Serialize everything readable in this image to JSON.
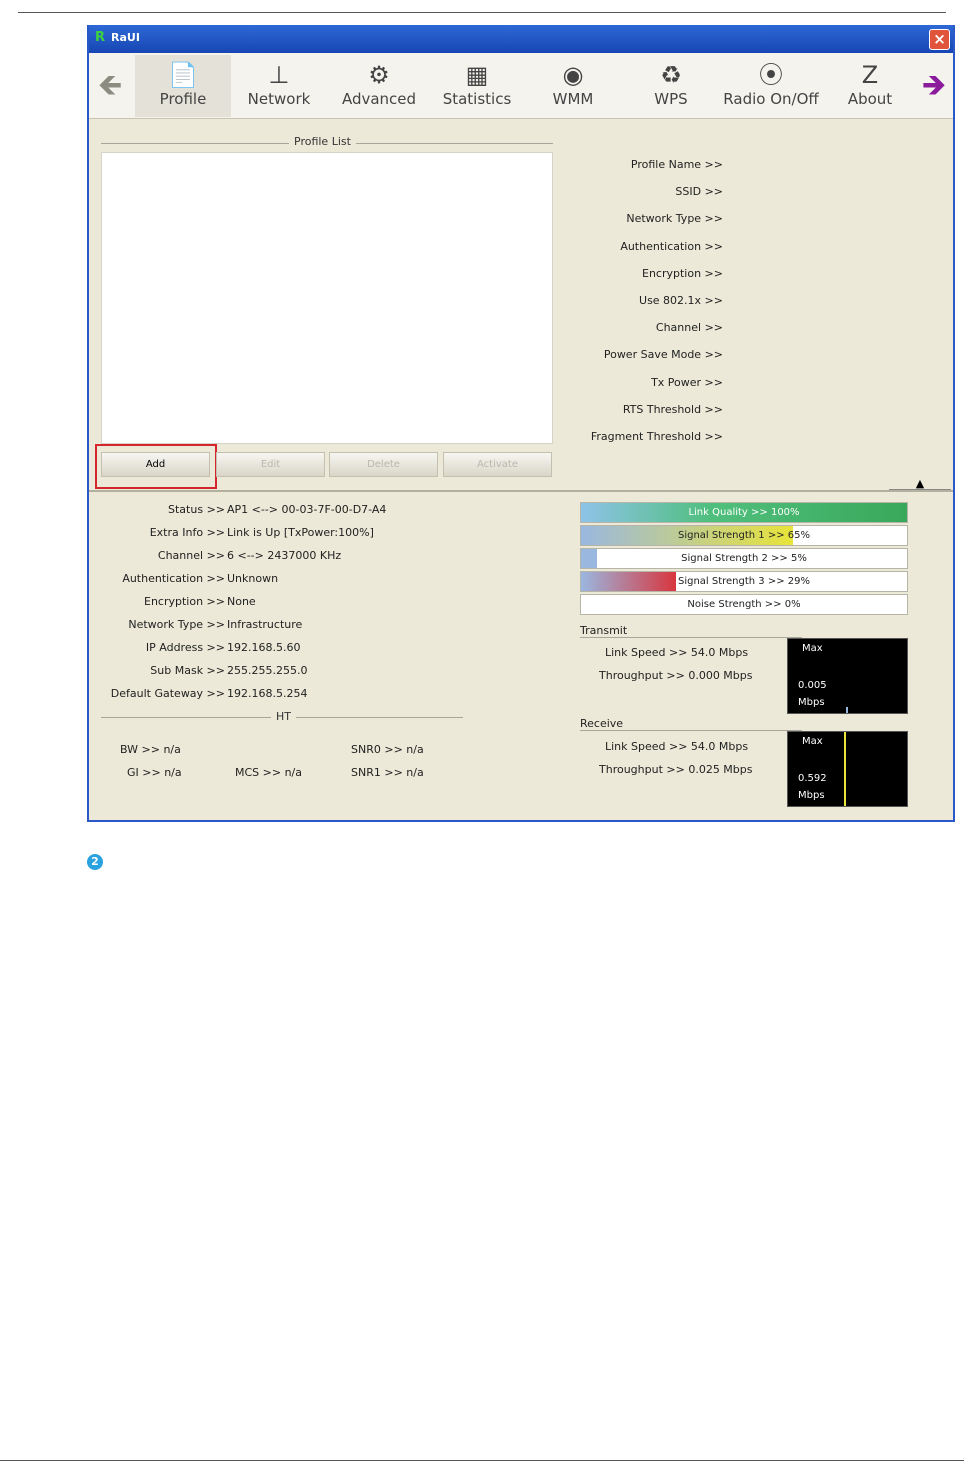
{
  "window": {
    "title": "RaUI",
    "close": "×"
  },
  "toolbar": {
    "back": "🡸",
    "forward": "🡺",
    "items": [
      {
        "label": "Profile",
        "icon": "📄"
      },
      {
        "label": "Network",
        "icon": "⊥"
      },
      {
        "label": "Advanced",
        "icon": "⚙"
      },
      {
        "label": "Statistics",
        "icon": "▦"
      },
      {
        "label": "WMM",
        "icon": "◉"
      },
      {
        "label": "WPS",
        "icon": "♻"
      },
      {
        "label": "Radio On/Off",
        "icon": "⦿"
      },
      {
        "label": "About",
        "icon": "Z"
      }
    ]
  },
  "profile": {
    "list_title": "Profile List",
    "buttons": {
      "add": "Add",
      "edit": "Edit",
      "delete": "Delete",
      "activate": "Activate"
    },
    "fields": [
      "Profile Name >>",
      "SSID >>",
      "Network Type >>",
      "Authentication >>",
      "Encryption >>",
      "Use 802.1x >>",
      "Channel >>",
      "Power Save Mode >>",
      "Tx Power >>",
      "RTS Threshold >>",
      "Fragment Threshold >>"
    ],
    "collapse_icon": "▲"
  },
  "status": {
    "rows": [
      {
        "label": "Status >>",
        "value": "AP1 <--> 00-03-7F-00-D7-A4"
      },
      {
        "label": "Extra Info >>",
        "value": "Link is Up [TxPower:100%]"
      },
      {
        "label": "Channel >>",
        "value": "6 <--> 2437000 KHz"
      },
      {
        "label": "Authentication >>",
        "value": "Unknown"
      },
      {
        "label": "Encryption >>",
        "value": "None"
      },
      {
        "label": "Network Type >>",
        "value": "Infrastructure"
      },
      {
        "label": "IP Address >>",
        "value": "192.168.5.60"
      },
      {
        "label": "Sub Mask >>",
        "value": "255.255.255.0"
      },
      {
        "label": "Default Gateway >>",
        "value": "192.168.5.254"
      }
    ],
    "ht_title": "HT",
    "ht": {
      "bw": "BW >> n/a",
      "gi": "GI >> n/a",
      "mcs": "MCS >> n/a",
      "snr0": "SNR0 >> n/a",
      "snr1": "SNR1 >> n/a"
    }
  },
  "signal": {
    "bars": [
      {
        "text": "Link Quality >> 100%",
        "level": 1.0,
        "color": "#4fbf7d"
      },
      {
        "text": "Signal Strength 1 >> 65%",
        "level": 0.65,
        "color": "#e8e43a"
      },
      {
        "text": "Signal Strength 2 >> 5%",
        "level": 0.05,
        "color": "#9ab7e0"
      },
      {
        "text": "Signal Strength 3 >> 29%",
        "level": 0.29,
        "color": "#d8363e"
      },
      {
        "text": "Noise Strength >> 0%",
        "level": 0.0,
        "color": "#9ab7e0"
      }
    ]
  },
  "transmit": {
    "title": "Transmit",
    "link_speed": "Link Speed >> 54.0 Mbps",
    "throughput": "Throughput >> 0.000 Mbps",
    "graph_max": "Max",
    "graph_value": "0.005",
    "graph_unit": "Mbps"
  },
  "receive": {
    "title": "Receive",
    "link_speed": "Link Speed >> 54.0 Mbps",
    "throughput": "Throughput >> 0.025 Mbps",
    "graph_max": "Max",
    "graph_value": "0.592",
    "graph_unit": "Mbps"
  },
  "footnote": {
    "bullet": "2"
  }
}
